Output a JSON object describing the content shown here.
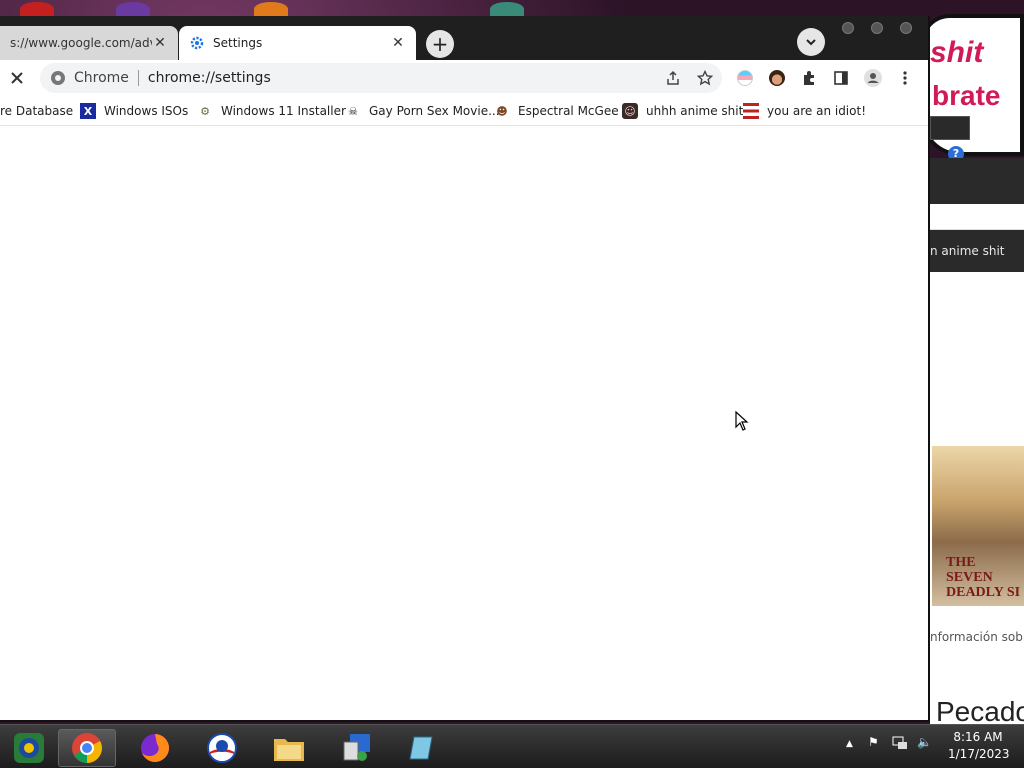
{
  "browser": {
    "tabs": [
      {
        "title": "s://www.google.com/advanced_",
        "active": false
      },
      {
        "title": "Settings",
        "active": true
      }
    ],
    "omnibox": {
      "site_label": "Chrome",
      "url": "chrome://settings"
    },
    "bookmarks": [
      {
        "label": "re Database",
        "icon": "partial-icon"
      },
      {
        "label": "Windows ISOs",
        "icon": "x-logo-icon"
      },
      {
        "label": "Windows 11 Installer",
        "icon": "installer-icon"
      },
      {
        "label": "Gay Porn Sex Movie...",
        "icon": "skull-icon"
      },
      {
        "label": "Espectral McGee",
        "icon": "character-icon"
      },
      {
        "label": "uhhh anime shit",
        "icon": "anime-face-icon"
      },
      {
        "label": "you are an idiot!",
        "icon": "flag-icon"
      }
    ]
  },
  "background": {
    "sticker_line1": "shit",
    "sticker_line2": "brate",
    "bookmark_text": "n anime shit",
    "info_text": "nformación sobre",
    "big_text": "Pecado",
    "anime_title": "THE SEVEN DEADLY SI"
  },
  "taskbar": {
    "apps": [
      "windows-start",
      "chrome",
      "firefox",
      "obama-campaign",
      "file-explorer",
      "control-panel",
      "notepad"
    ],
    "time": "8:16 AM",
    "date": "1/17/2023"
  },
  "colors": {
    "accent_blue": "#1a73e8",
    "tab_strip": "#1f1f1f",
    "sticker_text": "#d11a5a"
  }
}
